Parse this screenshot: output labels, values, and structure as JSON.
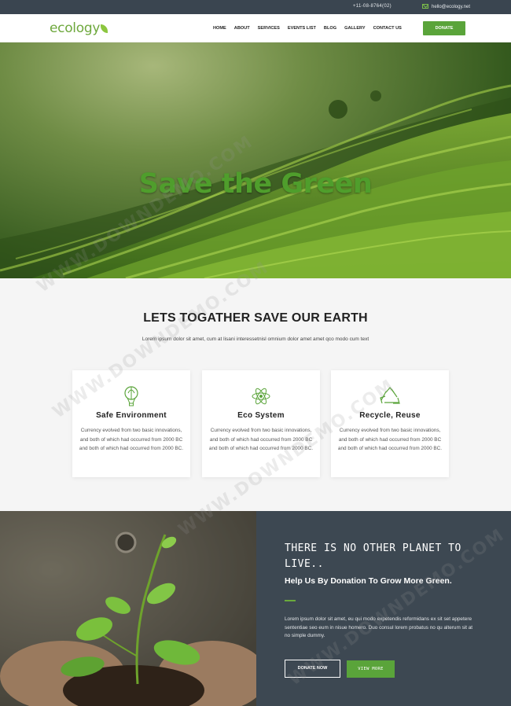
{
  "topbar": {
    "phone": "+11-08-8764(02)",
    "email": "hello@ecology.net"
  },
  "nav": {
    "logo": "ecology",
    "items": [
      "HOME",
      "ABOUT",
      "SERVICES",
      "EVENTS LIST",
      "BLOG",
      "GALLERY",
      "CONTACT US"
    ],
    "donate": "DONATE"
  },
  "hero": {
    "title": "Save the Green"
  },
  "intro": {
    "title": "LETS TOGATHER SAVE OUR EARTH",
    "subtitle": "Lorem ipsum dolor sit amet, cum at lisani interessetnisl omnium dolor amet amet qco modo cum text"
  },
  "cards": [
    {
      "icon": "balloon-icon",
      "title": "Safe Environment",
      "text": "Currency evolved from two basic innovations, and both of which had occurred from 2000 BC and both of which had occurred from 2000 BC."
    },
    {
      "icon": "atom-icon",
      "title": "Eco System",
      "text": "Currency evolved from two basic innovations, and both of which had occurred from 2000 BC and both of which had occurred from 2000 BC."
    },
    {
      "icon": "recycle-icon",
      "title": "Recycle, Reuse",
      "text": "Currency evolved from two basic innovations, and both of which had occurred from 2000 BC and both of which had occurred from 2000 BC."
    }
  ],
  "donation": {
    "title": "THERE IS NO OTHER PLANET TO LIVE..",
    "subtitle": "Help Us By Donation To Grow More Green.",
    "text": "Lorem ipsum dolor sit amet, eu qui modo expetendis reformidans ex sit set appetere sententiae seo eum in nisue homero. Duo consul lorem probatus no qu alterum sit at no simple dummy.",
    "btn_donate": "DONATE NOW",
    "btn_view": "VIEW MORE"
  },
  "watermark": "WWW.DOWNDEMO.COM",
  "colors": {
    "accent": "#5aa43a",
    "dark": "#3d4852",
    "topbar": "#3a4550"
  }
}
